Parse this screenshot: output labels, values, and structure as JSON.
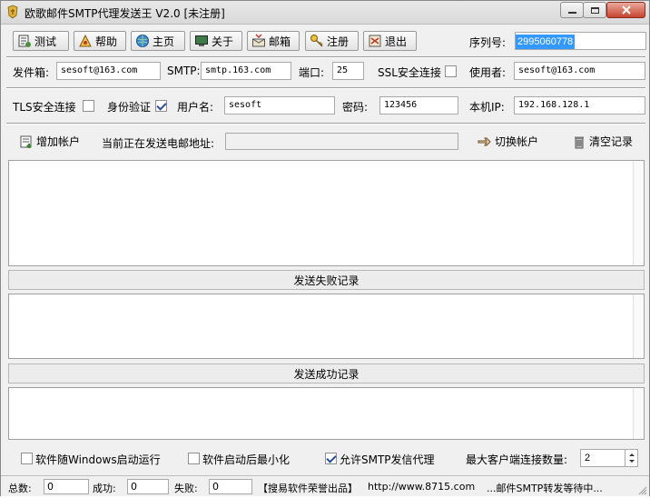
{
  "window": {
    "title": "欧歌邮件SMTP代理发送王 V2.0 [未注册]"
  },
  "toolbar": {
    "buttons": [
      {
        "label": "测试",
        "icon": "test-icon"
      },
      {
        "label": "帮助",
        "icon": "help-icon"
      },
      {
        "label": "主页",
        "icon": "globe-icon"
      },
      {
        "label": "关于",
        "icon": "monitor-icon"
      },
      {
        "label": "邮箱",
        "icon": "mailbox-icon"
      },
      {
        "label": "注册",
        "icon": "key-icon"
      },
      {
        "label": "退出",
        "icon": "exit-icon"
      }
    ],
    "serial_label": "序列号:",
    "serial_value": "2995060778"
  },
  "config": {
    "sender_label": "发件箱:",
    "sender_value": "sesoft@163.com",
    "smtp_label": "SMTP:",
    "smtp_value": "smtp.163.com",
    "port_label": "端口:",
    "port_value": "25",
    "ssl_label": "SSL安全连接",
    "user_label": "使用者:",
    "user_value": "sesoft@163.com",
    "tls_label": "TLS安全连接",
    "auth_label": "身份验证",
    "username_label": "用户名:",
    "username_value": "sesoft",
    "password_label": "密码:",
    "password_value": "123456",
    "localip_label": "本机IP:",
    "localip_value": "192.168.128.1"
  },
  "account_row": {
    "add_account": "增加帐户",
    "current_label": "当前正在发送电邮地址:",
    "current_value": "",
    "switch_account": "切换帐户",
    "clear_log": "清空记录"
  },
  "logs": {
    "fail_header": "发送失败记录",
    "success_header": "发送成功记录"
  },
  "options": {
    "startup_label": "软件随Windows启动运行",
    "minimize_label": "软件启动后最小化",
    "allow_proxy_label": "允许SMTP发信代理",
    "max_clients_label": "最大客户端连接数量:",
    "max_clients_value": "2"
  },
  "statusbar": {
    "total_label": "总数:",
    "total_value": "0",
    "success_label": "成功:",
    "success_value": "0",
    "fail_label": "失败:",
    "fail_value": "0",
    "brand": "【搜易软件荣誉出品】",
    "url": "http://www.8715.com",
    "status": "...邮件SMTP转发等待中..."
  },
  "colors": {
    "serial_highlight": "#3399ff",
    "check_mark": "#2b4e9b"
  }
}
